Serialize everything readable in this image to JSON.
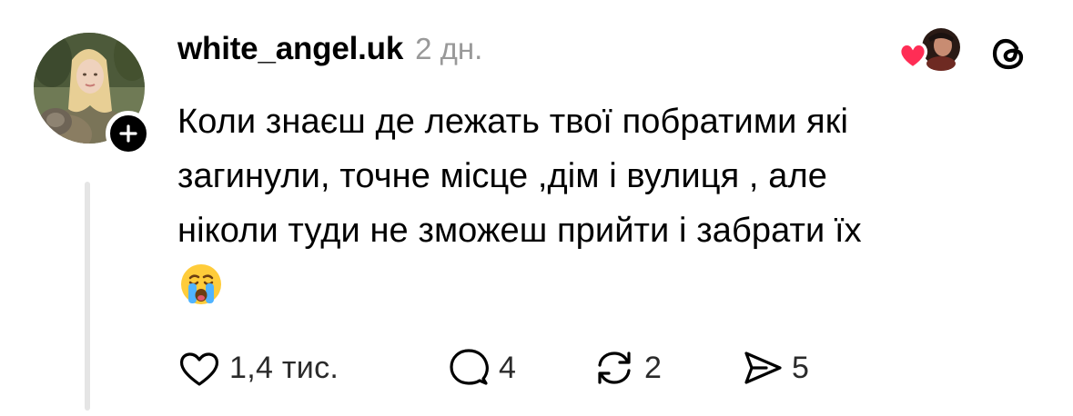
{
  "post": {
    "author": {
      "username": "white_angel.uk",
      "avatar_icon": "avatar-photo",
      "follow_icon": "plus-icon"
    },
    "timestamp": "2 дн.",
    "text": "Коли знаєш де лежать твої побратими які\nзагинули, точне місце ,дім і вулиця , але\nніколи туди не зможеш прийти і забрати їх",
    "emoji": "loudly-crying-face",
    "liked_by_icon": "heart-icon",
    "app_icon": "threads-logo-icon",
    "actions": {
      "likes": "1,4 тис.",
      "replies": "4",
      "reposts": "2",
      "shares": "5"
    }
  },
  "colors": {
    "text": "#000000",
    "muted": "#999999",
    "heart": "#ff2d55",
    "thread_line": "#e5e5e5"
  }
}
